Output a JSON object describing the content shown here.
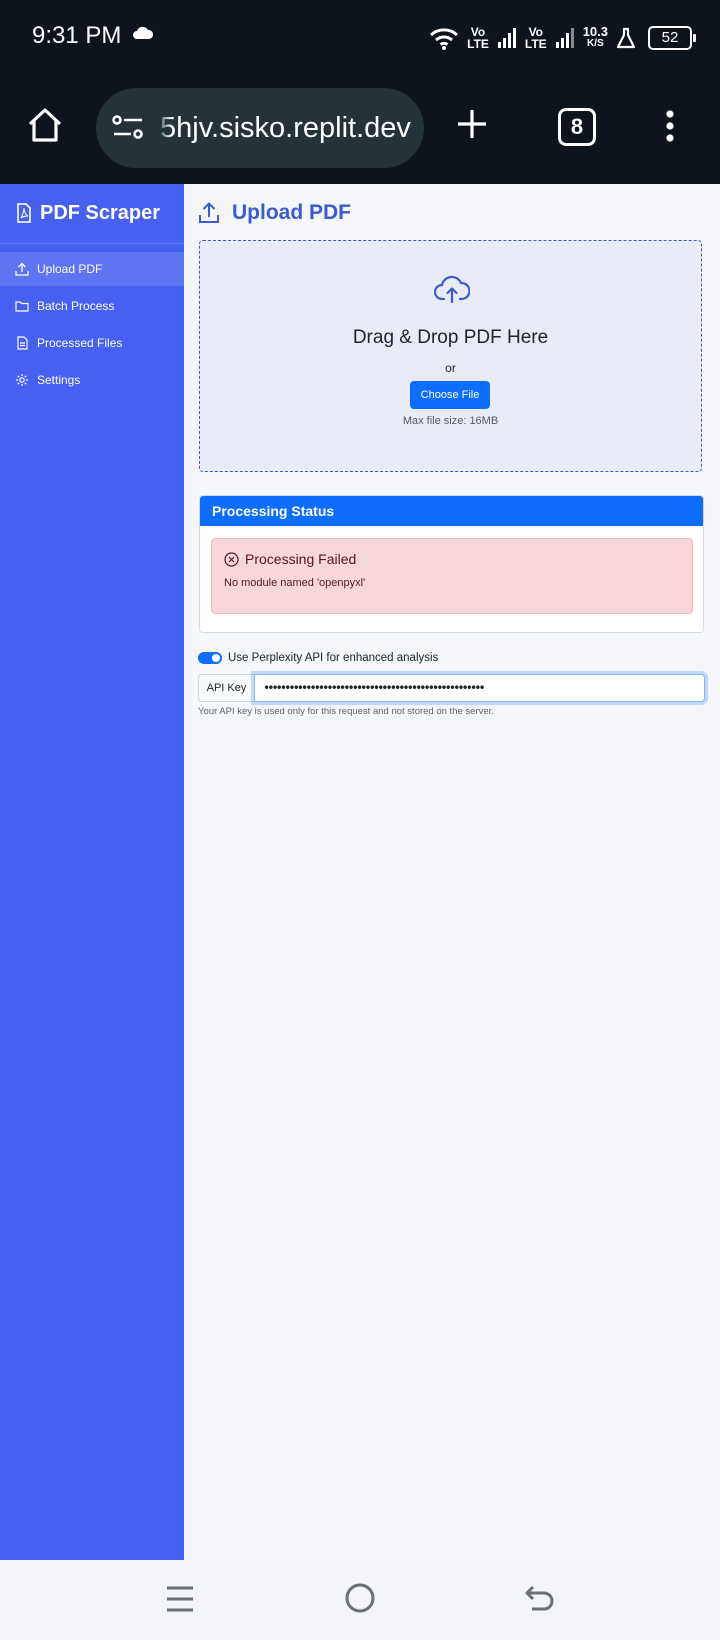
{
  "status_bar": {
    "time": "9:31 PM",
    "volte1_top": "Vo",
    "volte1_bottom": "LTE",
    "volte2_top": "Vo",
    "volte2_bottom": "LTE",
    "net_speed": "10.3",
    "net_unit": "K/S",
    "battery": "52"
  },
  "browser": {
    "url": "5hjv.sisko.replit.dev",
    "tab_count": "8"
  },
  "sidebar": {
    "brand": "PDF Scraper",
    "items": [
      {
        "label": "Upload PDF",
        "icon": "upload-icon",
        "active": true
      },
      {
        "label": "Batch Process",
        "icon": "folder-icon",
        "active": false
      },
      {
        "label": "Processed Files",
        "icon": "file-text-icon",
        "active": false
      },
      {
        "label": "Settings",
        "icon": "gear-icon",
        "active": false
      }
    ]
  },
  "main": {
    "title": "Upload PDF",
    "dropzone": {
      "title": "Drag & Drop PDF Here",
      "or": "or",
      "button": "Choose File",
      "max_size": "Max file size: 16MB"
    },
    "status": {
      "header": "Processing Status",
      "alert_title": "Processing Failed",
      "alert_message": "No module named 'openpyxl'"
    },
    "perplexity": {
      "toggle_label": "Use Perplexity API for enhanced analysis",
      "enabled": true,
      "api_label": "API Key",
      "api_value": "••••••••••••••••••••••••••••••••••••••••••••••••••••",
      "help": "Your API key is used only for this request and not stored on the server."
    }
  },
  "colors": {
    "sidebar": "#4660f2",
    "primary": "#0d6efd",
    "heading": "#3c5bd1",
    "alert_bg": "#f8d7da"
  }
}
